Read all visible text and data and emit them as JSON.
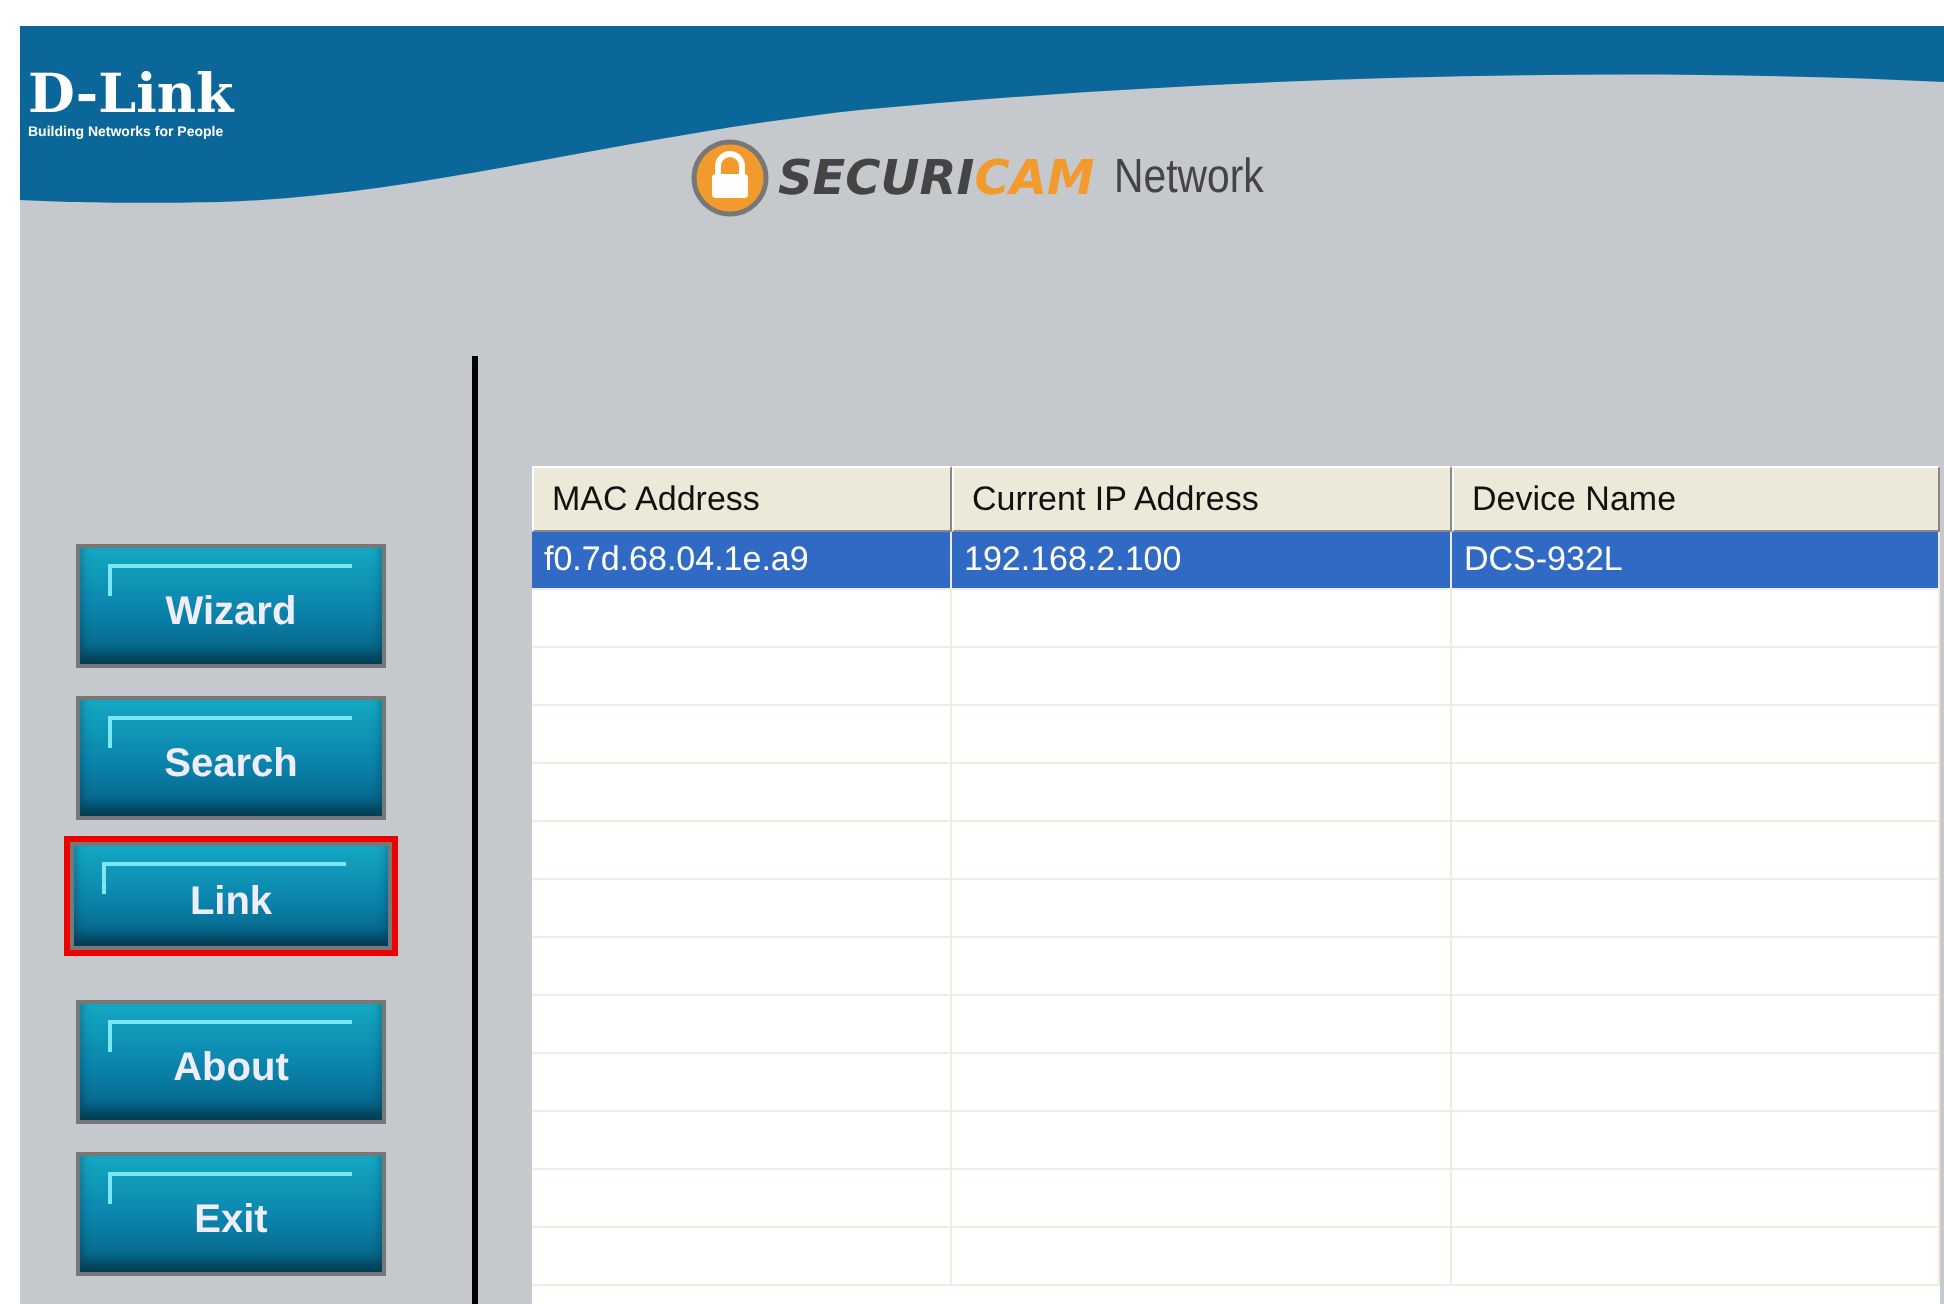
{
  "header": {
    "logo": "D-Link",
    "tagline": "Building Networks for People",
    "product": {
      "part_1": "SECURI",
      "part_2": "CAM",
      "part_3": "Network"
    }
  },
  "buttons": [
    {
      "label": "Wizard",
      "highlighted": false
    },
    {
      "label": "Search",
      "highlighted": false
    },
    {
      "label": "Link",
      "highlighted": true
    },
    {
      "label": "About",
      "highlighted": false
    },
    {
      "label": "Exit",
      "highlighted": false
    }
  ],
  "table": {
    "columns": [
      "MAC Address",
      "Current IP Address",
      "Device Name"
    ],
    "rows": [
      {
        "cells": [
          "f0.7d.68.04.1e.a9",
          "192.168.2.100",
          "DCS-932L"
        ],
        "selected": true
      }
    ]
  }
}
